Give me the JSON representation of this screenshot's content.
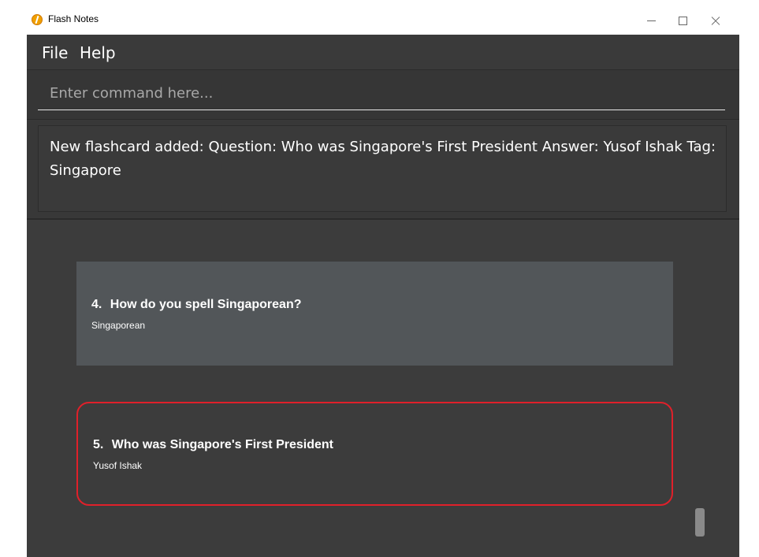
{
  "window": {
    "title": "Flash Notes",
    "icon": "flash-notes-app-icon"
  },
  "menu": {
    "file_label": "File",
    "help_label": "Help"
  },
  "command": {
    "placeholder": "Enter command here...",
    "value": ""
  },
  "result": {
    "message": "New flashcard added: Question: Who was Singapore's First President Answer: Yusof Ishak Tag: Singapore"
  },
  "flashcards": [
    {
      "index": "4.",
      "question": "How do you spell Singaporean?",
      "answer": "Singaporean"
    },
    {
      "index": "5.",
      "question": "Who was Singapore's First President",
      "answer": "Yusof Ishak"
    }
  ],
  "colors": {
    "background": "#3c3c3c",
    "selected_card": "#525659",
    "highlight_border": "#e0202a",
    "text": "#ffffff"
  }
}
